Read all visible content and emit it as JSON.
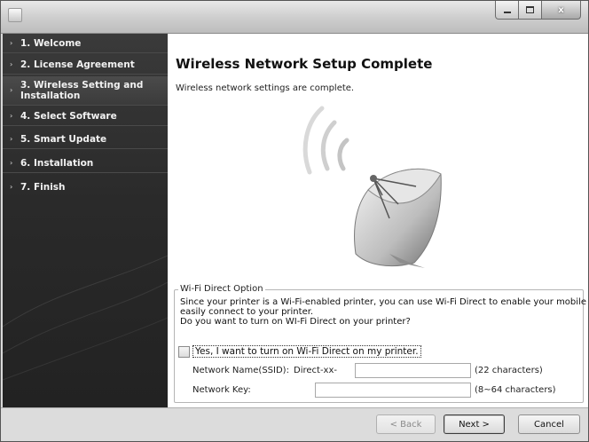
{
  "window": {
    "controls": {
      "minimize": "",
      "maximize": "",
      "close": "x"
    }
  },
  "sidebar": {
    "items": [
      {
        "label": "1. Welcome"
      },
      {
        "label": "2. License Agreement"
      },
      {
        "label": "3. Wireless Setting and Installation"
      },
      {
        "label": "4. Select Software"
      },
      {
        "label": "5. Smart Update"
      },
      {
        "label": "6. Installation"
      },
      {
        "label": "7. Finish"
      }
    ]
  },
  "main": {
    "title": "Wireless Network Setup Complete",
    "subtitle": "Wireless network settings are complete."
  },
  "wifi_direct": {
    "group_label": "Wi-Fi Direct Option",
    "desc_line1": "Since your printer is a Wi-Fi-enabled printer, you can use Wi-Fi Direct to enable your mobile device to",
    "desc_line2": "easily connect to your printer.",
    "desc_line3": "Do you want to turn on WI-Fi Direct on your printer?",
    "checkbox_label": "Yes, I want to turn on Wi-Fi Direct on my printer.",
    "checkbox_checked": false,
    "ssid_label": "Network Name(SSID):",
    "ssid_prefix": "Direct-xx-",
    "ssid_value": "",
    "ssid_hint": "(22 characters)",
    "key_label": "Network Key:",
    "key_value": "",
    "key_hint": "(8~64 characters)"
  },
  "buttons": {
    "back": "< Back",
    "next": "Next >",
    "cancel": "Cancel"
  }
}
